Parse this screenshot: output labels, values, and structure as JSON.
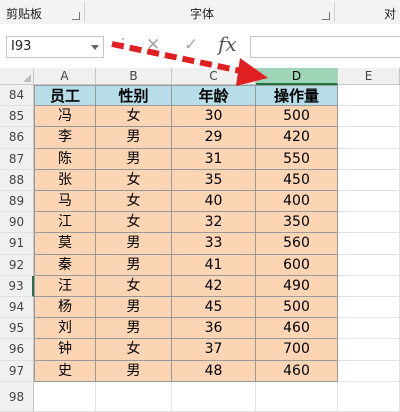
{
  "ribbon": {
    "group1": "剪贴板",
    "group2": "字体",
    "group3": "对"
  },
  "formula_bar": {
    "name_box": "I93",
    "formula": "",
    "fx_label": "fx"
  },
  "columns": [
    "A",
    "B",
    "C",
    "D",
    "E"
  ],
  "selected_column": "D",
  "header_row": {
    "row_number": "84",
    "cells": [
      "员工",
      "性别",
      "年龄",
      "操作量"
    ]
  },
  "rows": [
    {
      "row_number": "85",
      "cells": [
        "冯",
        "女",
        "30",
        "500"
      ]
    },
    {
      "row_number": "86",
      "cells": [
        "李",
        "男",
        "29",
        "420"
      ]
    },
    {
      "row_number": "87",
      "cells": [
        "陈",
        "男",
        "31",
        "550"
      ]
    },
    {
      "row_number": "88",
      "cells": [
        "张",
        "女",
        "35",
        "450"
      ]
    },
    {
      "row_number": "89",
      "cells": [
        "马",
        "女",
        "40",
        "400"
      ]
    },
    {
      "row_number": "90",
      "cells": [
        "江",
        "女",
        "32",
        "350"
      ]
    },
    {
      "row_number": "91",
      "cells": [
        "莫",
        "男",
        "33",
        "560"
      ]
    },
    {
      "row_number": "92",
      "cells": [
        "秦",
        "男",
        "41",
        "600"
      ]
    },
    {
      "row_number": "93",
      "cells": [
        "汪",
        "女",
        "42",
        "490"
      ]
    },
    {
      "row_number": "94",
      "cells": [
        "杨",
        "男",
        "45",
        "500"
      ]
    },
    {
      "row_number": "95",
      "cells": [
        "刘",
        "男",
        "36",
        "460"
      ]
    },
    {
      "row_number": "96",
      "cells": [
        "钟",
        "女",
        "37",
        "700"
      ]
    },
    {
      "row_number": "97",
      "cells": [
        "史",
        "男",
        "48",
        "460"
      ]
    }
  ],
  "trailing_rows": [
    "98"
  ],
  "annotation": {
    "arrow_color": "#e02020"
  }
}
